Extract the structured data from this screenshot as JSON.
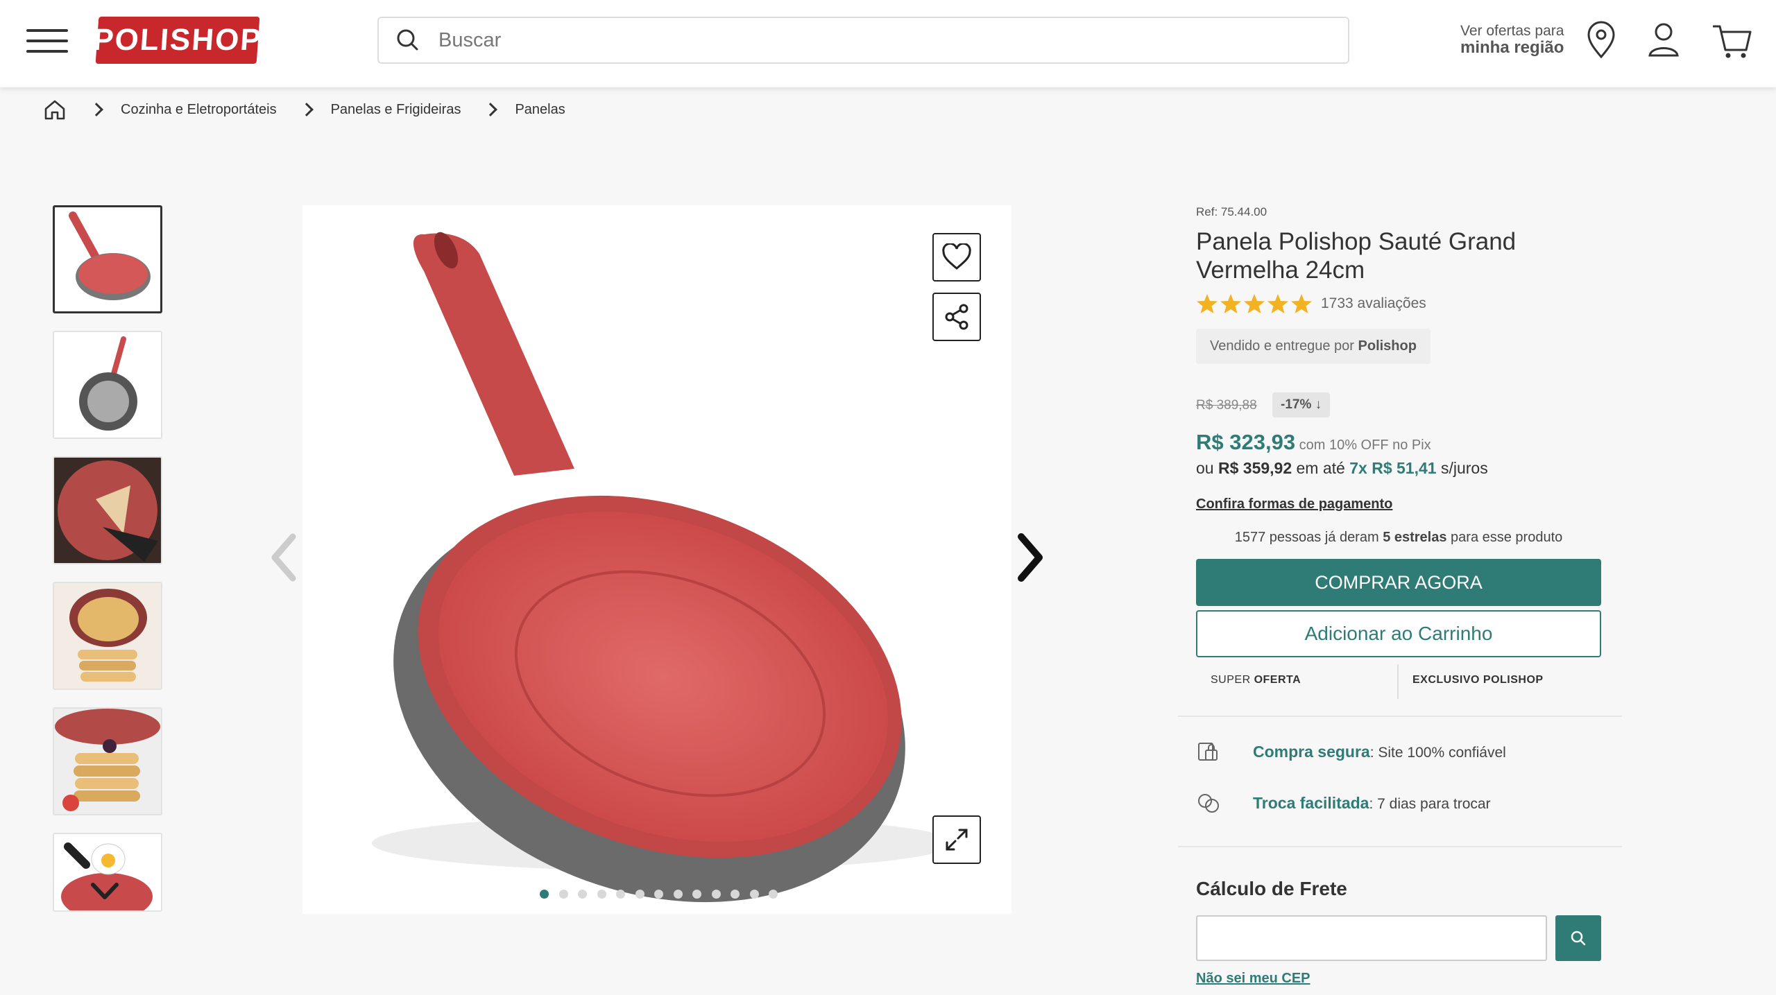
{
  "header": {
    "logo_text": "POLISHOP",
    "search_placeholder": "Buscar",
    "region_line1": "Ver ofertas para",
    "region_line2": "minha região"
  },
  "breadcrumb": [
    "Cozinha e Eletroportáteis",
    "Panelas e Frigideiras",
    "Panelas"
  ],
  "gallery": {
    "thumbnail_count": 6,
    "dot_count": 13,
    "active_dot": 0
  },
  "product": {
    "ref": "Ref: 75.44.00",
    "title": "Panela Polishop Sauté Grand Vermelha 24cm",
    "stars": 5,
    "reviews": "1733 avaliações",
    "seller_prefix": "Vendido e entregue por ",
    "seller_name": "Polishop",
    "old_price": "R$ 389,88",
    "discount": "-17%",
    "price": "R$ 323,93",
    "pix_note": " com 10% OFF no Pix",
    "install_prefix": "ou ",
    "install_total": "R$ 359,92",
    "install_mid": " em até ",
    "install_plan": "7x R$ 51,41",
    "install_suffix": " s/juros",
    "payment_link": "Confira formas de pagamento",
    "social_prefix": "1577 pessoas já deram ",
    "social_bold": "5 estrelas",
    "social_suffix": " para esse produto",
    "buy_label": "COMPRAR AGORA",
    "cart_label": "Adicionar ao Carrinho",
    "badge1_a": "SUPER ",
    "badge1_b": "OFERTA",
    "badge2": "EXCLUSIVO POLISHOP",
    "feature1_bold": "Compra segura",
    "feature1_text": ": Site 100% confiável",
    "feature2_bold": "Troca facilitada",
    "feature2_text": ": 7 dias para trocar",
    "shipping_title": "Cálculo de Frete",
    "cep_link": "Não sei meu CEP"
  },
  "colors": {
    "brand_red": "#c8272c",
    "accent_teal": "#2f7b76",
    "star_gold": "#f3b222"
  }
}
